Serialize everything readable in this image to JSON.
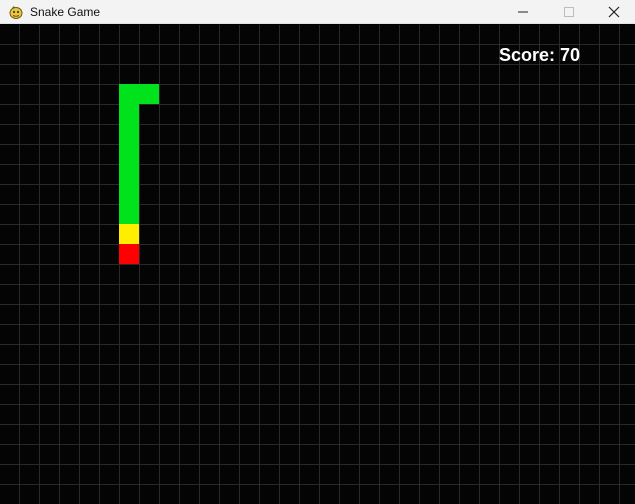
{
  "window": {
    "title": "Snake Game",
    "controls": {
      "minimize_icon": "minimize-icon",
      "maximize_icon": "maximize-icon",
      "close_icon": "close-icon"
    }
  },
  "score": {
    "label": "Score:",
    "value": "70"
  },
  "colors": {
    "background": "#040404",
    "grid": "#2a2a2a",
    "snake_body": "#00e21c",
    "snake_neck": "#ffee00",
    "snake_head": "#ff0000",
    "score_text": "#ffffff"
  },
  "snake": {
    "segments": [
      {
        "col": 6,
        "row": 3,
        "part": "body"
      },
      {
        "col": 7,
        "row": 3,
        "part": "body"
      },
      {
        "col": 6,
        "row": 4,
        "part": "body"
      },
      {
        "col": 6,
        "row": 5,
        "part": "body"
      },
      {
        "col": 6,
        "row": 6,
        "part": "body"
      },
      {
        "col": 6,
        "row": 7,
        "part": "body"
      },
      {
        "col": 6,
        "row": 8,
        "part": "body"
      },
      {
        "col": 6,
        "row": 9,
        "part": "body"
      },
      {
        "col": 6,
        "row": 10,
        "part": "neck"
      },
      {
        "col": 6,
        "row": 11,
        "part": "head"
      }
    ]
  }
}
